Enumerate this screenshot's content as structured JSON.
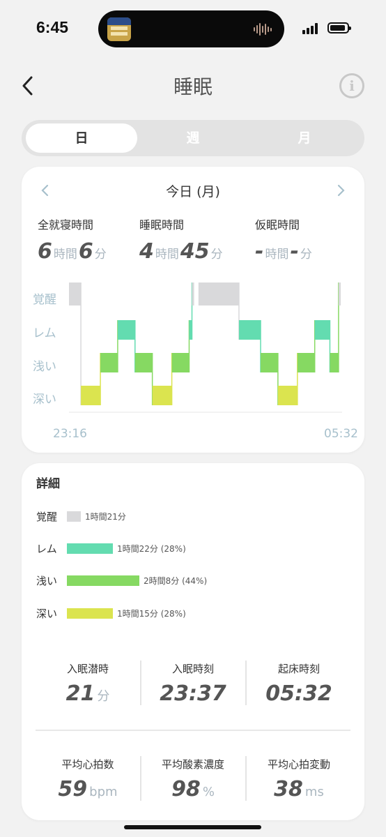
{
  "status": {
    "time": "6:45"
  },
  "header": {
    "title": "睡眠",
    "back_icon": "chevron-left-icon",
    "info_icon": "info-icon",
    "info_glyph": "i"
  },
  "tabs": [
    {
      "label": "日",
      "active": true
    },
    {
      "label": "週",
      "active": false
    },
    {
      "label": "月",
      "active": false
    }
  ],
  "summary": {
    "date_label": "今日 (月)",
    "stats": [
      {
        "label": "全就寝時間",
        "hours": "6",
        "h_unit": "時間",
        "minutes": "6",
        "m_unit": "分"
      },
      {
        "label": "睡眠時間",
        "hours": "4",
        "h_unit": "時間",
        "minutes": "45",
        "m_unit": "分"
      },
      {
        "label": "仮眠時間",
        "hours": "-",
        "h_unit": "時間",
        "minutes": "-",
        "m_unit": "分"
      }
    ]
  },
  "chart_data": {
    "type": "sleep-hypnogram",
    "stages": [
      "覚醒",
      "レム",
      "浅い",
      "深い"
    ],
    "stage_colors": {
      "覚醒": "#d9d9db",
      "レム": "#63dcb0",
      "浅い": "#86d962",
      "深い": "#dbe44f"
    },
    "start_time": "23:16",
    "end_time": "05:32",
    "segments": [
      {
        "stage": "覚醒",
        "start": 0.0,
        "end": 0.055
      },
      {
        "stage": "深い",
        "start": 0.055,
        "end": 0.145
      },
      {
        "stage": "浅い",
        "start": 0.145,
        "end": 0.225
      },
      {
        "stage": "レム",
        "start": 0.225,
        "end": 0.305
      },
      {
        "stage": "浅い",
        "start": 0.305,
        "end": 0.385
      },
      {
        "stage": "深い",
        "start": 0.385,
        "end": 0.475
      },
      {
        "stage": "浅い",
        "start": 0.475,
        "end": 0.555
      },
      {
        "stage": "レム",
        "start": 0.555,
        "end": 0.568
      },
      {
        "stage": "覚醒",
        "start": 0.568,
        "end": 0.578
      },
      {
        "stage": "覚醒",
        "start": 0.598,
        "end": 0.785
      },
      {
        "stage": "レム",
        "start": 0.785,
        "end": 0.885
      },
      {
        "stage": "浅い",
        "start": 0.885,
        "end": 0.965
      },
      {
        "stage": "深い",
        "start": 0.965,
        "end": 1.055
      },
      {
        "stage": "浅い",
        "start": 1.055,
        "end": 1.135
      },
      {
        "stage": "レム",
        "start": 1.135,
        "end": 1.205
      },
      {
        "stage": "浅い",
        "start": 1.205,
        "end": 1.245
      },
      {
        "stage": "覚醒",
        "start": 1.245,
        "end": 1.255
      }
    ],
    "x_min": 0,
    "x_max": 1.255
  },
  "details": {
    "title": "詳細",
    "rows": [
      {
        "stage": "覚醒",
        "text": "1時間21分",
        "fraction": 0.0,
        "color": "#d9d9db"
      },
      {
        "stage": "レム",
        "text": "1時間22分 (28%)",
        "fraction": 0.28,
        "color": "#63dcb0"
      },
      {
        "stage": "浅い",
        "text": "2時間8分 (44%)",
        "fraction": 0.44,
        "color": "#86d962"
      },
      {
        "stage": "深い",
        "text": "1時間15分 (28%)",
        "fraction": 0.28,
        "color": "#dbe44f"
      }
    ],
    "metrics_top": [
      {
        "label": "入眠潜時",
        "value": "21",
        "unit": "分"
      },
      {
        "label": "入眠時刻",
        "value": "23:37",
        "unit": ""
      },
      {
        "label": "起床時刻",
        "value": "05:32",
        "unit": ""
      }
    ],
    "metrics_bottom": [
      {
        "label": "平均心拍数",
        "value": "59",
        "unit": "bpm"
      },
      {
        "label": "平均酸素濃度",
        "value": "98",
        "unit": "%"
      },
      {
        "label": "平均心拍変動",
        "value": "38",
        "unit": "ms"
      }
    ]
  }
}
